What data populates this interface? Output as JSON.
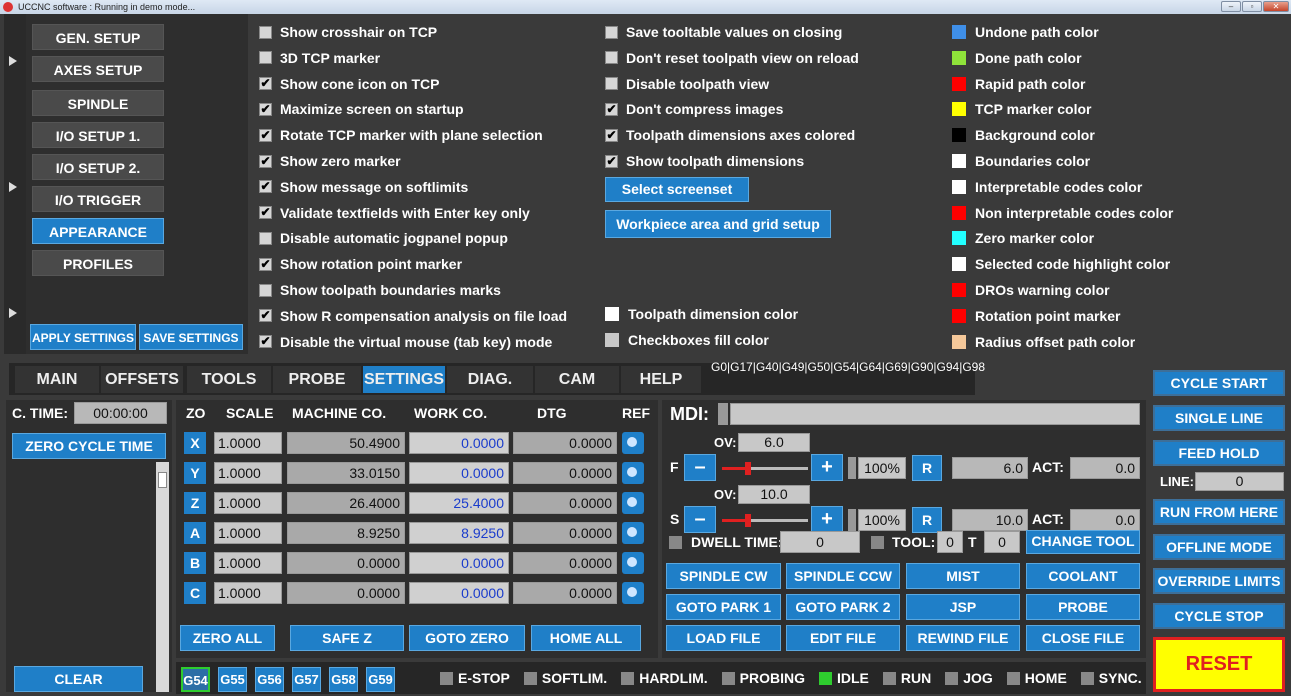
{
  "window": {
    "title": "UCCNC software : Running in demo mode..."
  },
  "menu": {
    "items": [
      "GEN. SETUP",
      "AXES SETUP",
      "SPINDLE",
      "I/O SETUP 1.",
      "I/O SETUP 2.",
      "I/O TRIGGER",
      "APPEARANCE",
      "PROFILES"
    ],
    "active": "APPEARANCE",
    "apply_label": "APPLY SETTINGS",
    "save_label": "SAVE SETTINGS"
  },
  "options_col1": [
    {
      "label": "Show crosshair on TCP",
      "checked": false
    },
    {
      "label": "3D TCP marker",
      "checked": false
    },
    {
      "label": "Show cone icon on TCP",
      "checked": true
    },
    {
      "label": "Maximize screen on startup",
      "checked": true
    },
    {
      "label": "Rotate TCP marker with plane selection",
      "checked": true
    },
    {
      "label": "Show zero marker",
      "checked": true
    },
    {
      "label": "Show message on softlimits",
      "checked": true
    },
    {
      "label": "Validate textfields with Enter key only",
      "checked": true
    },
    {
      "label": "Disable automatic jogpanel popup",
      "checked": false
    },
    {
      "label": "Show rotation point marker",
      "checked": true
    },
    {
      "label": "Show toolpath boundaries marks",
      "checked": false
    },
    {
      "label": "Show R compensation analysis on file load",
      "checked": true
    },
    {
      "label": "Disable the virtual mouse (tab key) mode",
      "checked": true
    }
  ],
  "options_col2": [
    {
      "label": "Save tooltable values on closing",
      "checked": false
    },
    {
      "label": "Don't reset toolpath view on reload",
      "checked": false
    },
    {
      "label": "Disable toolpath view",
      "checked": false
    },
    {
      "label": "Don't compress images",
      "checked": true
    },
    {
      "label": "Toolpath dimensions axes colored",
      "checked": true
    },
    {
      "label": "Show toolpath dimensions",
      "checked": true
    }
  ],
  "buttons_col2": {
    "select_screenset": "Select screenset",
    "workpiece_setup": "Workpiece area and grid setup"
  },
  "colors_col2": [
    {
      "label": "Toolpath dimension color",
      "color": "#ffffff"
    },
    {
      "label": "Checkboxes fill color",
      "color": "#c8c8c8"
    }
  ],
  "colors_col3": [
    {
      "label": "Undone path color",
      "color": "#3f8fe8"
    },
    {
      "label": "Done path color",
      "color": "#8fe33a"
    },
    {
      "label": "Rapid path color",
      "color": "#ff0000"
    },
    {
      "label": "TCP marker color",
      "color": "#ffff00"
    },
    {
      "label": "Background color",
      "color": "#000000"
    },
    {
      "label": "Boundaries color",
      "color": "#ffffff"
    },
    {
      "label": "Interpretable codes color",
      "color": "#ffffff"
    },
    {
      "label": "Non interpretable codes color",
      "color": "#ff0000"
    },
    {
      "label": "Zero marker color",
      "color": "#22ffff"
    },
    {
      "label": "Selected code highlight color",
      "color": "#ffffff"
    },
    {
      "label": "DROs warning color",
      "color": "#ff0000"
    },
    {
      "label": "Rotation point marker",
      "color": "#ff0000"
    },
    {
      "label": "Radius offset path color",
      "color": "#f5c89a"
    }
  ],
  "tabs": [
    "MAIN",
    "OFFSETS",
    "TOOLS",
    "PROBE",
    "SETTINGS",
    "DIAG.",
    "CAM",
    "HELP"
  ],
  "active_tab": "SETTINGS",
  "modal_codes": "G0|G17|G40|G49|G50|G54|G64|G69|G90|G94|G98",
  "cycle": {
    "time_label": "C. TIME:",
    "time_value": "00:00:00",
    "zero_label": "ZERO CYCLE TIME",
    "clear_label": "CLEAR"
  },
  "dro": {
    "headers": {
      "zo": "ZO",
      "scale": "SCALE",
      "machine": "MACHINE CO.",
      "work": "WORK CO.",
      "dtg": "DTG",
      "ref": "REF"
    },
    "axes": [
      {
        "name": "X",
        "scale": "1.0000",
        "machine": "50.4900",
        "work": "0.0000",
        "dtg": "0.0000"
      },
      {
        "name": "Y",
        "scale": "1.0000",
        "machine": "33.0150",
        "work": "0.0000",
        "dtg": "0.0000"
      },
      {
        "name": "Z",
        "scale": "1.0000",
        "machine": "26.4000",
        "work": "25.4000",
        "dtg": "0.0000"
      },
      {
        "name": "A",
        "scale": "1.0000",
        "machine": "8.9250",
        "work": "8.9250",
        "dtg": "0.0000"
      },
      {
        "name": "B",
        "scale": "1.0000",
        "machine": "0.0000",
        "work": "0.0000",
        "dtg": "0.0000"
      },
      {
        "name": "C",
        "scale": "1.0000",
        "machine": "0.0000",
        "work": "0.0000",
        "dtg": "0.0000"
      }
    ],
    "buttons": [
      "ZERO ALL",
      "SAFE Z",
      "GOTO ZERO",
      "HOME ALL"
    ]
  },
  "mdi": {
    "label": "MDI:",
    "value": ""
  },
  "feed": {
    "label": "F",
    "ov_label": "OV:",
    "ov_value": "6.0",
    "percent": "100%",
    "r_label": "R",
    "value": "6.0",
    "act_label": "ACT:",
    "act_value": "0.0",
    "slider_fraction": 0.3
  },
  "spindle": {
    "label": "S",
    "ov_label": "OV:",
    "ov_value": "10.0",
    "percent": "100%",
    "r_label": "R",
    "value": "10.0",
    "act_label": "ACT:",
    "act_value": "0.0",
    "slider_fraction": 0.3
  },
  "dwell": {
    "label": "DWELL TIME:",
    "value": "0",
    "tool_label": "TOOL:",
    "tool_value": "0",
    "t_label": "T",
    "t_value": "0",
    "change_tool": "CHANGE TOOL"
  },
  "ctrl_buttons": [
    [
      "SPINDLE CW",
      "SPINDLE CCW",
      "MIST",
      "COOLANT"
    ],
    [
      "GOTO PARK 1",
      "GOTO PARK 2",
      "JSP",
      "PROBE"
    ],
    [
      "LOAD FILE",
      "EDIT FILE",
      "REWIND FILE",
      "CLOSE FILE"
    ]
  ],
  "right_buttons": [
    "CYCLE START",
    "SINGLE LINE",
    "FEED HOLD",
    "RUN FROM HERE",
    "OFFLINE MODE",
    "OVERRIDE LIMITS",
    "CYCLE STOP"
  ],
  "line": {
    "label": "LINE:",
    "value": "0"
  },
  "reset_label": "RESET",
  "wcs": [
    "G54",
    "G55",
    "G56",
    "G57",
    "G58",
    "G59"
  ],
  "active_wcs": "G54",
  "status": [
    {
      "label": "E-STOP",
      "on": false
    },
    {
      "label": "SOFTLIM.",
      "on": false
    },
    {
      "label": "HARDLIM.",
      "on": false
    },
    {
      "label": "PROBING",
      "on": false
    },
    {
      "label": "IDLE",
      "on": true
    },
    {
      "label": "RUN",
      "on": false
    },
    {
      "label": "JOG",
      "on": false
    },
    {
      "label": "HOME",
      "on": false
    },
    {
      "label": "SYNC.",
      "on": false
    }
  ]
}
